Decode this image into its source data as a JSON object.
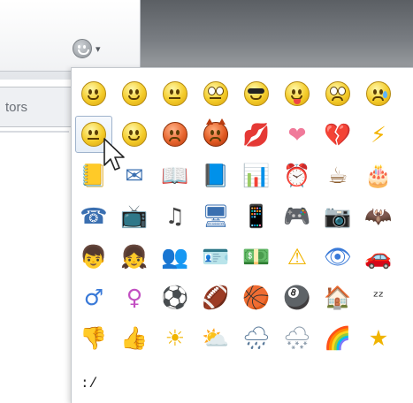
{
  "background": {
    "tab_label": "tors"
  },
  "toolbar": {
    "smiley_button_icon": "gray-smiley-icon",
    "dropdown_caret": "▾"
  },
  "smileys": {
    "rows": [
      [
        {
          "name": "smile-icon",
          "kind": "face",
          "variant": "smile"
        },
        {
          "name": "happy-icon",
          "kind": "face",
          "variant": "smile2"
        },
        {
          "name": "neutral-icon",
          "kind": "face",
          "variant": "flat"
        },
        {
          "name": "rolling-eyes-icon",
          "kind": "face",
          "variant": "roll"
        },
        {
          "name": "cool-sunglasses-icon",
          "kind": "face",
          "variant": "cool"
        },
        {
          "name": "tongue-icon",
          "kind": "face",
          "variant": "tongue"
        },
        {
          "name": "surprised-icon",
          "kind": "face",
          "variant": "wide"
        },
        {
          "name": "crying-icon",
          "kind": "face",
          "variant": "cry"
        }
      ],
      [
        {
          "name": "confused-icon",
          "kind": "face",
          "variant": "flat",
          "selected": true
        },
        {
          "name": "smirk-icon",
          "kind": "face",
          "variant": "smile2"
        },
        {
          "name": "angry-icon",
          "kind": "face",
          "variant": "angry"
        },
        {
          "name": "devil-icon",
          "kind": "face",
          "variant": "devil"
        },
        {
          "name": "kiss-lips-icon",
          "kind": "glyph",
          "glyph": "💋"
        },
        {
          "name": "heart-icon",
          "kind": "glyph",
          "glyph": "❤"
        },
        {
          "name": "broken-heart-icon",
          "kind": "glyph",
          "glyph": "💔"
        },
        {
          "name": "lightning-icon",
          "kind": "glyph",
          "glyph": "⚡"
        }
      ],
      [
        {
          "name": "notebook-icon",
          "kind": "glyph",
          "glyph": "📒"
        },
        {
          "name": "envelope-icon",
          "kind": "glyph",
          "glyph": "✉"
        },
        {
          "name": "open-book-icon",
          "kind": "glyph",
          "glyph": "📖"
        },
        {
          "name": "book-icon",
          "kind": "glyph",
          "glyph": "📘"
        },
        {
          "name": "bar-chart-icon",
          "kind": "glyph",
          "glyph": "📊"
        },
        {
          "name": "alarm-clock-icon",
          "kind": "glyph",
          "glyph": "⏰"
        },
        {
          "name": "coffee-cup-icon",
          "kind": "glyph",
          "glyph": "☕"
        },
        {
          "name": "birthday-cake-icon",
          "kind": "glyph",
          "glyph": "🎂"
        }
      ],
      [
        {
          "name": "telephone-icon",
          "kind": "glyph",
          "glyph": "☎"
        },
        {
          "name": "television-icon",
          "kind": "glyph",
          "glyph": "📺"
        },
        {
          "name": "music-note-icon",
          "kind": "glyph",
          "glyph": "♫"
        },
        {
          "name": "computer-icon",
          "kind": "glyph",
          "glyph": "🖥"
        },
        {
          "name": "ipod-icon",
          "kind": "glyph",
          "glyph": "📱"
        },
        {
          "name": "gamepad-icon",
          "kind": "glyph",
          "glyph": "🎮"
        },
        {
          "name": "webcam-icon",
          "kind": "glyph",
          "glyph": "📷"
        },
        {
          "name": "bat-icon",
          "kind": "glyph",
          "glyph": "🦇"
        }
      ],
      [
        {
          "name": "boy-icon",
          "kind": "glyph",
          "glyph": "👦"
        },
        {
          "name": "girl-icon",
          "kind": "glyph",
          "glyph": "👧"
        },
        {
          "name": "contacts-icon",
          "kind": "glyph",
          "glyph": "👥"
        },
        {
          "name": "id-card-icon",
          "kind": "glyph",
          "glyph": "🪪"
        },
        {
          "name": "money-icon",
          "kind": "glyph",
          "glyph": "💵"
        },
        {
          "name": "warning-icon",
          "kind": "glyph",
          "glyph": "⚠"
        },
        {
          "name": "eye-icon",
          "kind": "glyph",
          "glyph": "👁"
        },
        {
          "name": "car-icon",
          "kind": "glyph",
          "glyph": "🚗"
        }
      ],
      [
        {
          "name": "male-sign-icon",
          "kind": "glyph",
          "glyph": "♂"
        },
        {
          "name": "female-sign-icon",
          "kind": "glyph",
          "glyph": "♀"
        },
        {
          "name": "soccer-ball-icon",
          "kind": "glyph",
          "glyph": "⚽"
        },
        {
          "name": "football-icon",
          "kind": "glyph",
          "glyph": "🏈"
        },
        {
          "name": "basketball-icon",
          "kind": "glyph",
          "glyph": "🏀"
        },
        {
          "name": "eight-ball-icon",
          "kind": "glyph",
          "glyph": "🎱"
        },
        {
          "name": "house-icon",
          "kind": "glyph",
          "glyph": "🏠"
        },
        {
          "name": "sleep-zz-icon",
          "kind": "glyph",
          "glyph": "ᶻᶻ"
        }
      ],
      [
        {
          "name": "thumbs-down-icon",
          "kind": "glyph",
          "glyph": "👎"
        },
        {
          "name": "thumbs-up-icon",
          "kind": "glyph",
          "glyph": "👍"
        },
        {
          "name": "sun-icon",
          "kind": "glyph",
          "glyph": "☀"
        },
        {
          "name": "partly-cloudy-icon",
          "kind": "glyph",
          "glyph": "⛅"
        },
        {
          "name": "rain-cloud-icon",
          "kind": "glyph",
          "glyph": "🌧"
        },
        {
          "name": "snow-cloud-icon",
          "kind": "glyph",
          "glyph": "🌨"
        },
        {
          "name": "rainbow-icon",
          "kind": "glyph",
          "glyph": "🌈"
        },
        {
          "name": "star-icon",
          "kind": "glyph",
          "glyph": "★"
        }
      ]
    ],
    "extra_text": ":/"
  },
  "colors": {
    "glyph_default": "#3a6fb0",
    "selected_border": "#9fb3cc"
  }
}
